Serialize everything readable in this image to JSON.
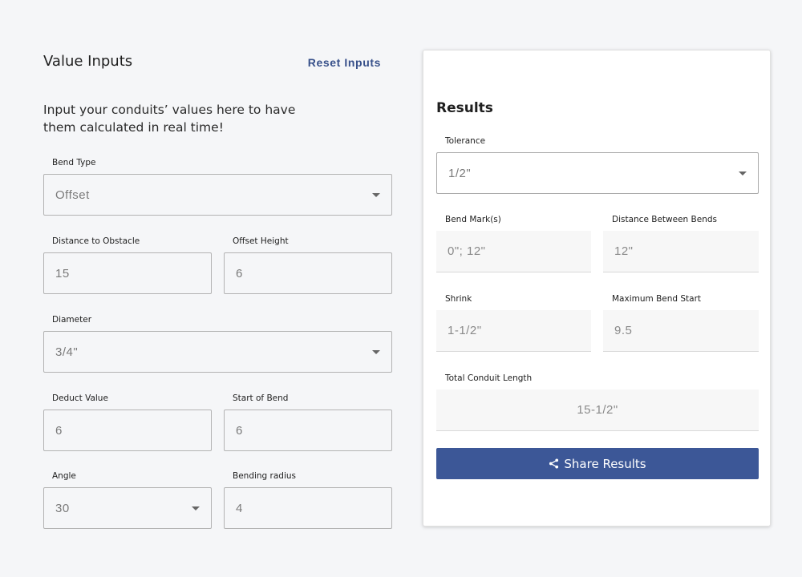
{
  "inputs": {
    "heading": "Value Inputs",
    "reset_label": "Reset Inputs",
    "intro": "Input your conduits’ values here to have them calculated in real time!",
    "bend_type": {
      "label": "Bend Type",
      "value": "Offset"
    },
    "distance_to_obstacle": {
      "label": "Distance to Obstacle",
      "value": "15"
    },
    "offset_height": {
      "label": "Offset Height",
      "value": "6"
    },
    "diameter": {
      "label": "Diameter",
      "value": "3/4\""
    },
    "deduct_value": {
      "label": "Deduct Value",
      "value": "6"
    },
    "start_of_bend": {
      "label": "Start of Bend",
      "value": "6"
    },
    "angle": {
      "label": "Angle",
      "value": "30"
    },
    "bending_radius": {
      "label": "Bending radius",
      "value": "4"
    }
  },
  "results": {
    "title": "Results",
    "tolerance": {
      "label": "Tolerance",
      "value": "1/2\""
    },
    "bend_marks": {
      "label": "Bend Mark(s)",
      "value": "0\"; 12\""
    },
    "distance_between_bends": {
      "label": "Distance Between Bends",
      "value": "12\""
    },
    "shrink": {
      "label": "Shrink",
      "value": "1-1/2\""
    },
    "maximum_bend_start": {
      "label": "Maximum Bend Start",
      "value": "9.5"
    },
    "total_conduit_length": {
      "label": "Total Conduit Length",
      "value": "15-1/2\""
    },
    "share_label": "Share Results"
  },
  "icons": {
    "dropdown": "chevron-down-icon",
    "share": "share-icon"
  },
  "colors": {
    "accent": "#3c5797",
    "reset_link": "#37508a",
    "background": "#f5f6f8"
  }
}
